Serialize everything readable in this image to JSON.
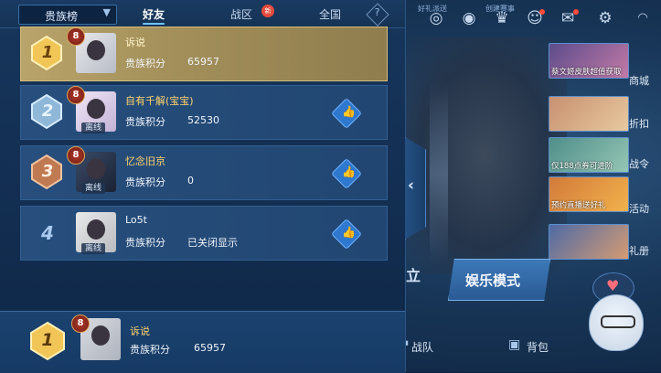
{
  "leaderboard": {
    "category_select": "贵族榜",
    "tabs": [
      {
        "label": "好友",
        "active": true
      },
      {
        "label": "战区",
        "active": false,
        "badge": "新"
      },
      {
        "label": "全国",
        "active": false
      }
    ],
    "help_icon": "?",
    "rows": [
      {
        "rank": "1",
        "level": "8",
        "name": "诉说",
        "points_label": "贵族积分",
        "points": "65957",
        "status": "",
        "highlight": true
      },
      {
        "rank": "2",
        "level": "8",
        "name": "自有千解(宝宝)",
        "points_label": "贵族积分",
        "points": "52530",
        "status": "离线",
        "highlight": false
      },
      {
        "rank": "3",
        "level": "8",
        "name": "忆念旧京",
        "points_label": "贵族积分",
        "points": "0",
        "status": "离线",
        "highlight": false
      },
      {
        "rank": "4",
        "level": "",
        "name": "Lo5t",
        "points_label": "贵族积分",
        "points": "已关闭显示",
        "status": "离线",
        "highlight": false
      }
    ],
    "self": {
      "rank": "1",
      "level": "8",
      "name": "诉说",
      "points_label": "贵族积分",
      "points": "65957"
    }
  },
  "hud": {
    "top_texts": [
      "好礼派送",
      "创建赛事"
    ],
    "side_cards": [
      {
        "text": "蔡文姬皮肤超值获取",
        "label": "商城"
      },
      {
        "text": "",
        "label": "折扣"
      },
      {
        "text": "仅188点券可进阶",
        "label": "战令"
      },
      {
        "text": "预约直播送好礼",
        "label": "活动"
      },
      {
        "text": "",
        "label": "礼册"
      }
    ],
    "mode_left": "立",
    "mode_button": "娱乐模式",
    "bottom_nav": [
      "战队",
      "背包"
    ]
  },
  "colors": {
    "gold": "#ffd46a",
    "accent": "#6cc3ff",
    "panel": "#17365c"
  }
}
